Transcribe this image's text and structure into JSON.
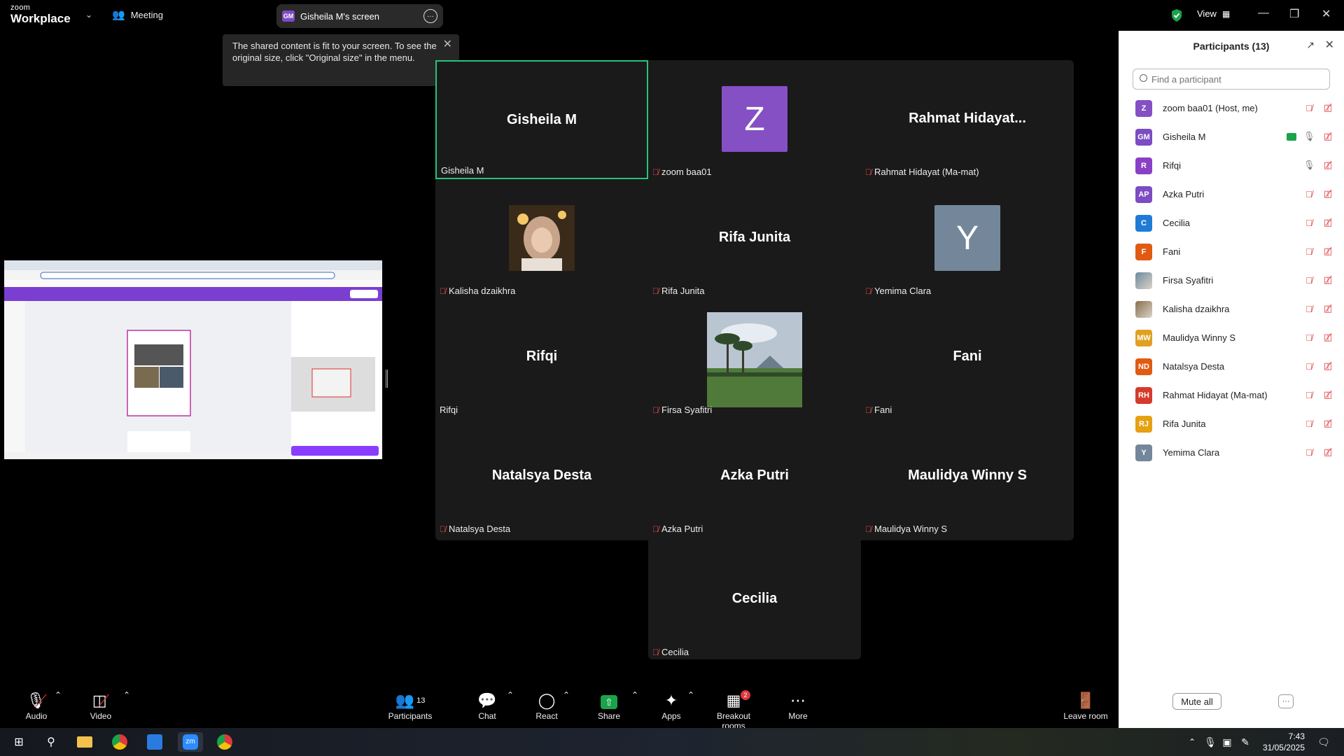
{
  "app": {
    "brand_small": "zoom",
    "brand_big": "Workplace",
    "meeting_label": "Meeting"
  },
  "share_pill": {
    "initials": "GM",
    "label": "Gisheila M's screen"
  },
  "view": {
    "label": "View"
  },
  "tooltip": {
    "text": "The shared content is fit to your screen. To see the original size, click \"Original size\" in the menu."
  },
  "tiles": [
    {
      "name": "Gisheila M",
      "label": "Gisheila M",
      "muted": false,
      "type": "name",
      "active": true
    },
    {
      "name": "Z",
      "label": "zoom baa01",
      "muted": true,
      "type": "avatar",
      "color": "#8450c4"
    },
    {
      "name": "Rahmat Hidayat...",
      "label": "Rahmat Hidayat (Ma-mat)",
      "muted": true,
      "type": "name"
    },
    {
      "name": "",
      "label": "Kalisha dzaikhra",
      "muted": true,
      "type": "photo"
    },
    {
      "name": "Rifa Junita",
      "label": "Rifa Junita",
      "muted": true,
      "type": "name"
    },
    {
      "name": "Y",
      "label": "Yemima Clara",
      "muted": true,
      "type": "avatar",
      "color": "#74879a"
    },
    {
      "name": "Rifqi",
      "label": "Rifqi",
      "muted": false,
      "type": "name"
    },
    {
      "name": "",
      "label": "Firsa Syafitri",
      "muted": true,
      "type": "photo"
    },
    {
      "name": "Fani",
      "label": "Fani",
      "muted": true,
      "type": "name"
    },
    {
      "name": "Natalsya Desta",
      "label": "Natalsya Desta",
      "muted": true,
      "type": "name"
    },
    {
      "name": "Azka Putri",
      "label": "Azka Putri",
      "muted": true,
      "type": "name"
    },
    {
      "name": "Maulidya Winny S",
      "label": "Maulidya Winny S",
      "muted": true,
      "type": "name"
    },
    {
      "name": "Cecilia",
      "label": "Cecilia",
      "muted": true,
      "type": "name"
    }
  ],
  "panel": {
    "title": "Participants (13)",
    "search_placeholder": "Find a participant",
    "participants": [
      {
        "initials": "Z",
        "name": "zoom baa01 (Host, me)",
        "color": "#8450c4",
        "mic": "muted",
        "share": false
      },
      {
        "initials": "GM",
        "name": "Gisheila M",
        "color": "#7b4cc2",
        "mic": "on",
        "share": true
      },
      {
        "initials": "R",
        "name": "Rifqi",
        "color": "#8a3fc4",
        "mic": "on",
        "share": false
      },
      {
        "initials": "AP",
        "name": "Azka Putri",
        "color": "#7b4cc2",
        "mic": "muted",
        "share": false
      },
      {
        "initials": "C",
        "name": "Cecilia",
        "color": "#1f7bd6",
        "mic": "muted",
        "share": false
      },
      {
        "initials": "F",
        "name": "Fani",
        "color": "#e05a12",
        "mic": "muted",
        "share": false
      },
      {
        "initials": "",
        "name": "Firsa Syafitri",
        "color": "#6d8aa0",
        "mic": "muted",
        "share": false,
        "photo": true
      },
      {
        "initials": "",
        "name": "Kalisha dzaikhra",
        "color": "#8a6f50",
        "mic": "muted",
        "share": false,
        "photo": true
      },
      {
        "initials": "MW",
        "name": "Maulidya Winny S",
        "color": "#e0a020",
        "mic": "muted",
        "share": false
      },
      {
        "initials": "ND",
        "name": "Natalsya Desta",
        "color": "#e05a12",
        "mic": "muted",
        "share": false
      },
      {
        "initials": "RH",
        "name": "Rahmat Hidayat (Ma-mat)",
        "color": "#d63a2a",
        "mic": "muted",
        "share": false
      },
      {
        "initials": "RJ",
        "name": "Rifa Junita",
        "color": "#e6a012",
        "mic": "muted",
        "share": false
      },
      {
        "initials": "Y",
        "name": "Yemima Clara",
        "color": "#74879a",
        "mic": "muted",
        "share": false
      }
    ],
    "mute_all": "Mute all"
  },
  "toolbar": {
    "audio": "Audio",
    "video": "Video",
    "participants": "Participants",
    "participants_count": "13",
    "chat": "Chat",
    "react": "React",
    "share": "Share",
    "apps": "Apps",
    "breakout": "Breakout rooms",
    "breakout_badge": "2",
    "more": "More",
    "leave": "Leave room"
  },
  "taskbar": {
    "time": "7:43",
    "date": "31/05/2025"
  }
}
